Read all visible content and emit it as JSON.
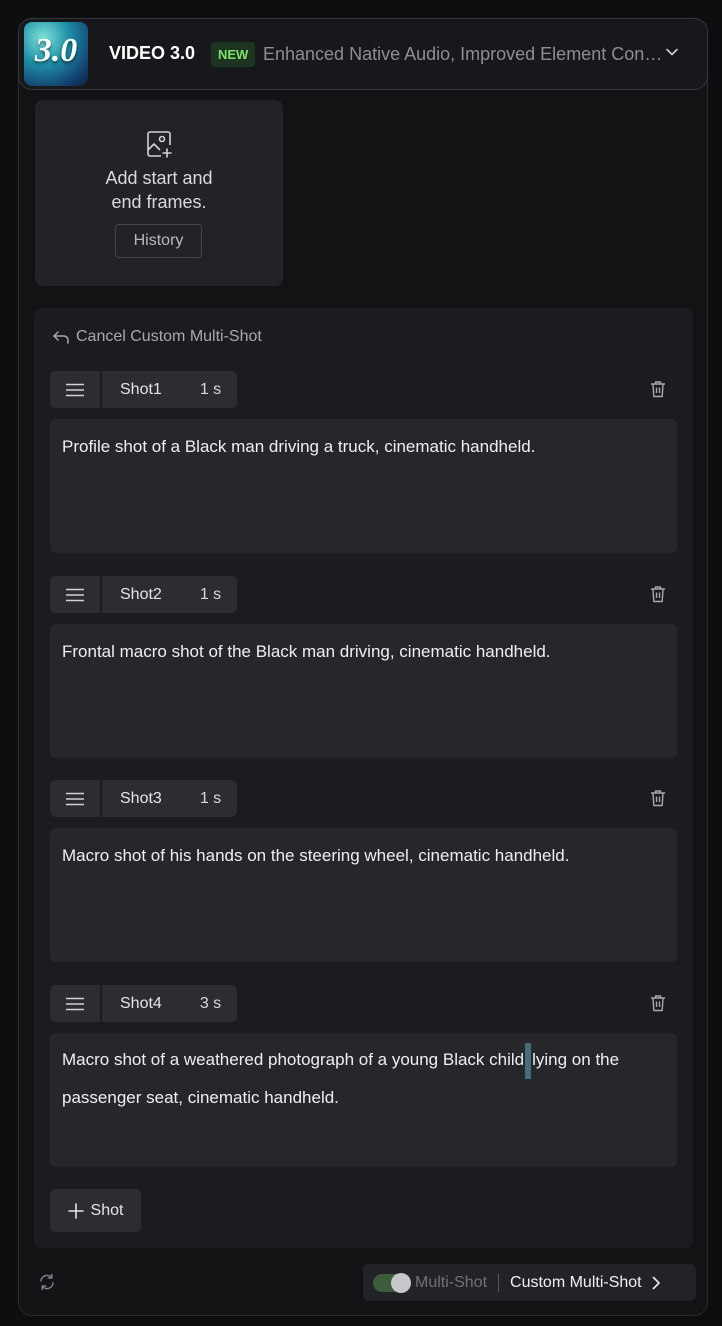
{
  "model": {
    "logo_text": "3.0",
    "name": "VIDEO 3.0",
    "badge": "NEW",
    "description": "Enhanced Native Audio, Improved Element Consistency"
  },
  "frames": {
    "prompt": "Add start and\nend frames.",
    "history_label": "History"
  },
  "multishot": {
    "cancel_label": "Cancel Custom Multi-Shot",
    "shots": [
      {
        "label": "Shot1",
        "duration": "1 s",
        "prompt": "Profile shot of a Black man driving a truck, cinematic handheld."
      },
      {
        "label": "Shot2",
        "duration": "1 s",
        "prompt": "Frontal macro shot of the Black man driving, cinematic handheld."
      },
      {
        "label": "Shot3",
        "duration": "1 s",
        "prompt": "Macro shot of his hands on the steering wheel, cinematic handheld."
      },
      {
        "label": "Shot4",
        "duration": "3 s",
        "prompt_before_cursor": "Macro shot of a weathered photograph of a young Black child",
        "prompt_after_cursor": "lying on the passenger seat, cinematic handheld."
      }
    ],
    "add_shot_label": "Shot"
  },
  "footer": {
    "multishot_toggle_label": "Multi-Shot",
    "multishot_toggle_on": true,
    "mode_label": "Custom Multi-Shot"
  },
  "colors": {
    "accent_green": "#7ee36b",
    "panel_bg": "#1b1c1f",
    "prompt_bg": "#26272b"
  }
}
